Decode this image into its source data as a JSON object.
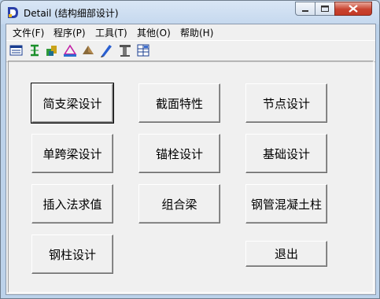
{
  "window": {
    "title": "Detail (结构细部设计)"
  },
  "colors": {
    "accent": "#bcd2ea",
    "close": "#c8432f"
  },
  "menu": [
    {
      "label": "文件(F)"
    },
    {
      "label": "程序(P)"
    },
    {
      "label": "工具(T)"
    },
    {
      "label": "其他(O)"
    },
    {
      "label": "帮助(H)"
    }
  ],
  "toolbar": [
    "report-icon",
    "section-icon",
    "beam-icon",
    "truss-icon",
    "base-icon",
    "pen-icon",
    "column-icon",
    "grid-icon"
  ],
  "buttons": [
    {
      "label": "简支梁设计"
    },
    {
      "label": "截面特性"
    },
    {
      "label": "节点设计"
    },
    {
      "label": "单跨梁设计"
    },
    {
      "label": "锚栓设计"
    },
    {
      "label": "基础设计"
    },
    {
      "label": "插入法求值"
    },
    {
      "label": "组合梁"
    },
    {
      "label": "钢管混凝土柱"
    },
    {
      "label": "钢柱设计"
    },
    {
      "label": "退出"
    }
  ]
}
